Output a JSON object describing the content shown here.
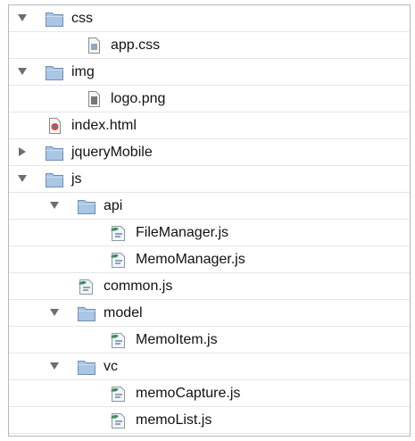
{
  "tree": {
    "rows": [
      {
        "label": "css",
        "kind": "folder",
        "state": "expanded"
      },
      {
        "label": "app.css",
        "kind": "file",
        "icon": "css-file-icon"
      },
      {
        "label": "img",
        "kind": "folder",
        "state": "expanded"
      },
      {
        "label": "logo.png",
        "kind": "file",
        "icon": "image-file-icon"
      },
      {
        "label": "index.html",
        "kind": "file",
        "icon": "html-file-icon"
      },
      {
        "label": "jqueryMobile",
        "kind": "folder",
        "state": "collapsed"
      },
      {
        "label": "js",
        "kind": "folder",
        "state": "expanded"
      },
      {
        "label": "api",
        "kind": "folder",
        "state": "expanded"
      },
      {
        "label": "FileManager.js",
        "kind": "file",
        "icon": "script-file-icon"
      },
      {
        "label": "MemoManager.js",
        "kind": "file",
        "icon": "script-file-icon"
      },
      {
        "label": "common.js",
        "kind": "file",
        "icon": "script-file-icon"
      },
      {
        "label": "model",
        "kind": "folder",
        "state": "expanded"
      },
      {
        "label": "MemoItem.js",
        "kind": "file",
        "icon": "script-file-icon"
      },
      {
        "label": "vc",
        "kind": "folder",
        "state": "expanded"
      },
      {
        "label": "memoCapture.js",
        "kind": "file",
        "icon": "script-file-icon"
      },
      {
        "label": "memoList.js",
        "kind": "file",
        "icon": "script-file-icon"
      }
    ]
  },
  "colors": {
    "folder_fill": "#a9c6e4",
    "folder_stroke": "#6d8fb4",
    "disclosure": "#6e6e6e",
    "row_divider": "#e6e6e6",
    "border": "#b6b6b6"
  }
}
